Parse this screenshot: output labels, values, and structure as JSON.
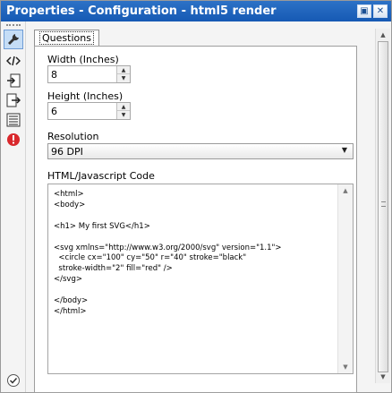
{
  "window": {
    "title": "Properties - Configuration - html5 render"
  },
  "toolbar_icons": [
    "wrench-icon",
    "code-icon",
    "input-icon",
    "output-icon",
    "list-icon",
    "error-icon",
    "check-icon"
  ],
  "tab": {
    "label": "Questions"
  },
  "fields": {
    "width_label": "Width (Inches)",
    "width_value": "8",
    "height_label": "Height (Inches)",
    "height_value": "6",
    "resolution_label": "Resolution",
    "resolution_value": "96 DPI",
    "code_label": "HTML/Javascript Code",
    "code_value": "<html>\n<body>\n\n<h1> My first SVG</h1>\n\n<svg xmlns=\"http://www.w3.org/2000/svg\" version=\"1.1\">\n  <circle cx=\"100\" cy=\"50\" r=\"40\" stroke=\"black\"\n  stroke-width=\"2\" fill=\"red\" />\n</svg>\n\n</body>\n</html>"
  },
  "colors": {
    "titlebar": "#1f64bb",
    "error": "#d9282c"
  }
}
